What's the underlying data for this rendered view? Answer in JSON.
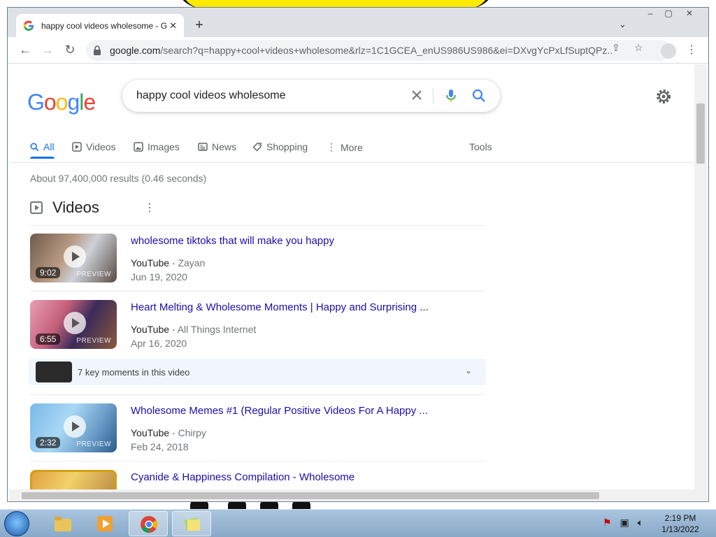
{
  "browser": {
    "tab_title": "happy cool videos wholesome - Google Search",
    "tab_close": "✕",
    "new_tab": "+",
    "url_host": "google.com",
    "url_path": "/search?q=happy+cool+videos+wholesome&rlz=1C1GCEA_enUS986US986&ei=DXvgYcPxLfSuptQPz..."
  },
  "google": {
    "logo_letters": [
      "G",
      "o",
      "o",
      "g",
      "l",
      "e"
    ],
    "query": "happy cool videos wholesome",
    "tabs": [
      {
        "label": "All",
        "icon": "search-icon"
      },
      {
        "label": "Videos",
        "icon": "video-icon"
      },
      {
        "label": "Images",
        "icon": "image-icon"
      },
      {
        "label": "News",
        "icon": "news-icon"
      },
      {
        "label": "Shopping",
        "icon": "tag-icon"
      },
      {
        "label": "More",
        "icon": "more-vert-icon"
      }
    ],
    "tools": "Tools",
    "stats": "About 97,400,000 results (0.46 seconds)",
    "videos_heading": "Videos",
    "videos": [
      {
        "title": "wholesome tiktoks that will make you happy",
        "source": "YouTube",
        "channel": "Zayan",
        "date": "Jun 19, 2020",
        "duration": "9:02",
        "preview": "PREVIEW"
      },
      {
        "title": "Heart Melting & Wholesome Moments | Happy and Surprising ...",
        "source": "YouTube",
        "channel": "All Things Internet",
        "date": "Apr 16, 2020",
        "duration": "6:55",
        "preview": "PREVIEW"
      },
      {
        "title": "Wholesome Memes #1 (Regular Positive Videos For A Happy ...",
        "source": "YouTube",
        "channel": "Chirpy",
        "date": "Feb 24, 2018",
        "duration": "2:32",
        "preview": "PREVIEW"
      },
      {
        "title": "Cyanide & Happiness Compilation - Wholesome"
      }
    ],
    "key_moments": "7 key moments in this video"
  },
  "taskbar": {
    "time": "2:19 PM",
    "date": "1/13/2022"
  },
  "colors": {
    "link": "#1a0dab",
    "accent": "#1a73e8"
  }
}
